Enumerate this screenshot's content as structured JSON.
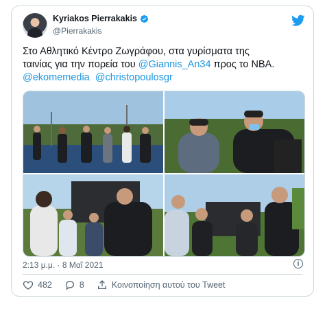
{
  "author": {
    "display_name": "Kyriakos Pierrakakis",
    "handle": "@Pierrakakis"
  },
  "tweet": {
    "line1": "Στο Αθλητικό Κέντρο Ζωγράφου, στα γυρίσματα της",
    "line2_prefix": "ταινίας για την πορεία του ",
    "mention1": "@Giannis_An34",
    "line2_suffix": " προς το NBA.",
    "mention2": "@ekomemedia",
    "mention3": "@christopoulosgr"
  },
  "timestamp": "2:13 μ.μ. · 8 Μαΐ 2021",
  "actions": {
    "likes": "482",
    "replies": "8",
    "share_label": "Κοινοποίηση αυτού του Tweet"
  },
  "colors": {
    "accent": "#1d9bf0",
    "mention": "#1b95e0",
    "secondary_text": "#536471",
    "border": "#cfd9de"
  },
  "icons": [
    "verified-badge-icon",
    "twitter-bird-icon",
    "info-icon",
    "heart-icon",
    "reply-icon",
    "share-icon"
  ]
}
